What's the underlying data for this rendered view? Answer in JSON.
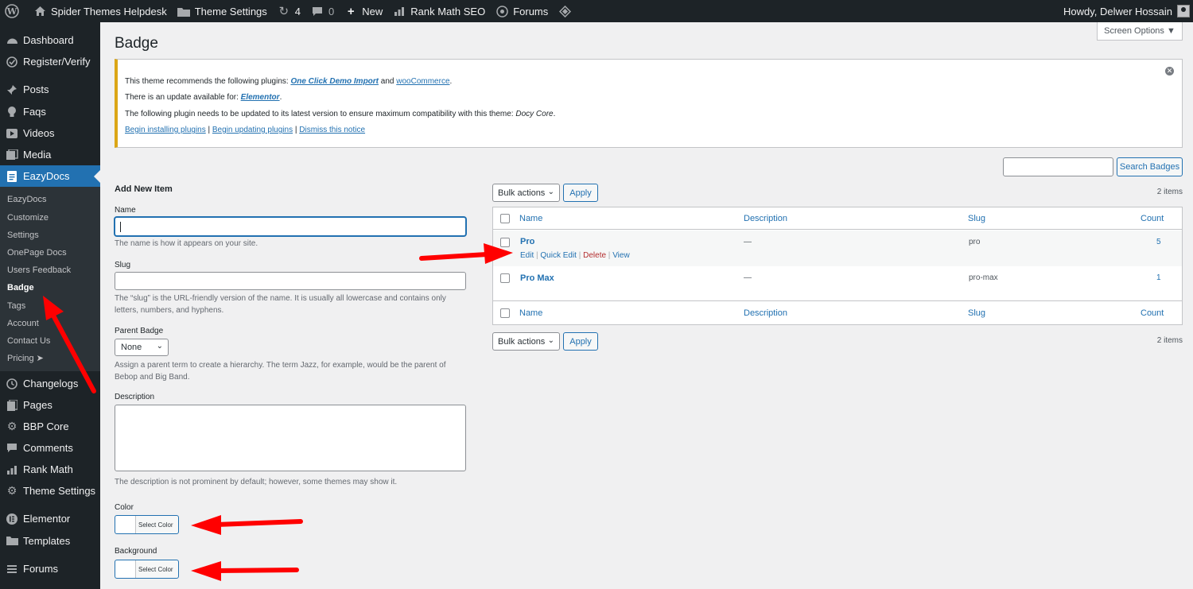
{
  "adminbar": {
    "site_name": "Spider Themes Helpdesk",
    "theme_settings": "Theme Settings",
    "updates_count": "4",
    "comments_count": "0",
    "new_label": "New",
    "rankmath_label": "Rank Math SEO",
    "forums_label": "Forums",
    "howdy": "Howdy, Delwer Hossain"
  },
  "sidebar": {
    "items": [
      {
        "label": "Dashboard",
        "icon": "dashboard-icon"
      },
      {
        "label": "Register/Verify",
        "icon": "register-icon"
      },
      {
        "label": "Posts",
        "icon": "pin-icon"
      },
      {
        "label": "Faqs",
        "icon": "bulb-icon"
      },
      {
        "label": "Videos",
        "icon": "video-icon"
      },
      {
        "label": "Media",
        "icon": "media-icon"
      },
      {
        "label": "EazyDocs",
        "icon": "docs-icon"
      },
      {
        "label": "Changelogs",
        "icon": "history-icon"
      },
      {
        "label": "Pages",
        "icon": "page-icon"
      },
      {
        "label": "BBP Core",
        "icon": "gear-icon"
      },
      {
        "label": "Comments",
        "icon": "comment-icon"
      },
      {
        "label": "Rank Math",
        "icon": "chart-icon"
      },
      {
        "label": "Theme Settings",
        "icon": "gear-icon"
      },
      {
        "label": "Elementor",
        "icon": "elementor-icon"
      },
      {
        "label": "Templates",
        "icon": "folder-icon"
      },
      {
        "label": "Forums",
        "icon": "forum-icon"
      }
    ],
    "submenu": [
      "EazyDocs",
      "Customize",
      "Settings",
      "OnePage Docs",
      "Users Feedback",
      "Badge",
      "Tags",
      "Account",
      "Contact Us",
      "Pricing ➤"
    ],
    "active_sub": "Badge"
  },
  "screen_options": "Screen Options ▼",
  "page_title": "Badge",
  "notice": {
    "line1_pre": "This theme recommends the following plugins: ",
    "line1_link1": "One Click Demo Import",
    "line1_mid": " and ",
    "line1_link2": "wooCommerce",
    "line1_post": ".",
    "line2_pre": "There is an update available for: ",
    "line2_link": "Elementor",
    "line2_post": ".",
    "line3": "The following plugin needs to be updated to its latest version to ensure maximum compatibility with this theme: ",
    "line3_em": "Docy Core",
    "line3_post": ".",
    "link_install": "Begin installing plugins",
    "link_update": "Begin updating plugins",
    "link_dismiss": "Dismiss this notice",
    "sep": " | "
  },
  "search_button": "Search Badges",
  "form": {
    "heading": "Add New Item",
    "name_label": "Name",
    "name_desc": "The name is how it appears on your site.",
    "slug_label": "Slug",
    "slug_desc": "The “slug” is the URL-friendly version of the name. It is usually all lowercase and contains only letters, numbers, and hyphens.",
    "parent_label": "Parent Badge",
    "parent_value": "None",
    "parent_desc": "Assign a parent term to create a hierarchy. The term Jazz, for example, would be the parent of Bebop and Big Band.",
    "description_label": "Description",
    "description_desc": "The description is not prominent by default; however, some themes may show it.",
    "color_label": "Color",
    "color_btn": "Select Color",
    "background_label": "Background",
    "background_btn": "Select Color"
  },
  "table": {
    "bulk_actions": "Bulk actions",
    "apply": "Apply",
    "items_count": "2 items",
    "columns": [
      "Name",
      "Description",
      "Slug",
      "Count"
    ],
    "rows": [
      {
        "name": "Pro",
        "description": "—",
        "slug": "pro",
        "count": "5"
      },
      {
        "name": "Pro Max",
        "description": "—",
        "slug": "pro-max",
        "count": "1"
      }
    ],
    "row_actions": {
      "edit": "Edit",
      "quick_edit": "Quick Edit",
      "delete": "Delete",
      "view": "View",
      "sep": " | "
    }
  },
  "colors": {
    "arrow": "#ff0000",
    "accent": "#2271b1",
    "notice_border": "#dba617"
  }
}
